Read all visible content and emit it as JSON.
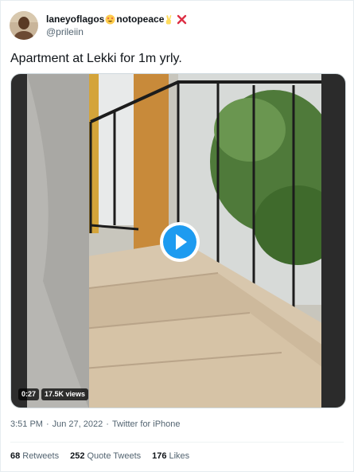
{
  "user": {
    "display_name": "laneyoflagos",
    "display_name_suffix": "notopeace",
    "handle": "@prileiin"
  },
  "tweet": {
    "text": "Apartment at Lekki for 1m yrly."
  },
  "video": {
    "duration": "0:27",
    "views": "17.5K views"
  },
  "meta": {
    "time": "3:51 PM",
    "separator": "·",
    "date": "Jun 27, 2022",
    "source": "Twitter for iPhone"
  },
  "stats": {
    "retweets_count": "68",
    "retweets_label": "Retweets",
    "quotes_count": "252",
    "quotes_label": "Quote Tweets",
    "likes_count": "176",
    "likes_label": "Likes"
  },
  "colors": {
    "accent": "#1d9bf0",
    "text": "#0f1419",
    "secondary": "#536471"
  },
  "icons": {
    "name_emoji_1": "heart-eyes-emoji-icon",
    "name_emoji_2": "victory-hand-emoji-icon",
    "name_emoji_3": "cross-mark-emoji-icon",
    "play": "play-icon"
  }
}
